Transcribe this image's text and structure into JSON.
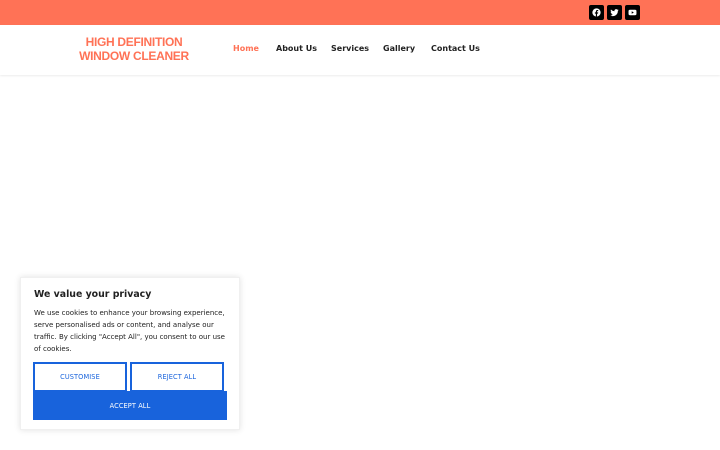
{
  "brand": {
    "line1": "HIGH DEFINITION",
    "line2": "WINDOW CLEANER",
    "accent_color": "#ff7256"
  },
  "social": [
    {
      "icon": "facebook-icon"
    },
    {
      "icon": "twitter-icon"
    },
    {
      "icon": "youtube-icon"
    }
  ],
  "nav": {
    "items": [
      {
        "label": "Home",
        "active": true
      },
      {
        "label": "About Us",
        "active": false
      },
      {
        "label": "Services",
        "active": false
      },
      {
        "label": "Gallery",
        "active": false
      },
      {
        "label": "Contact Us",
        "active": false
      }
    ]
  },
  "cookie_banner": {
    "title": "We value your privacy",
    "body": "We use cookies to enhance your browsing experience, serve personalised ads or content, and analyse our traffic. By clicking \"Accept All\", you consent to our use of cookies.",
    "customise_label": "CUSTOMISE",
    "reject_label": "REJECT ALL",
    "accept_label": "ACCEPT ALL",
    "button_color": "#1863dc"
  }
}
